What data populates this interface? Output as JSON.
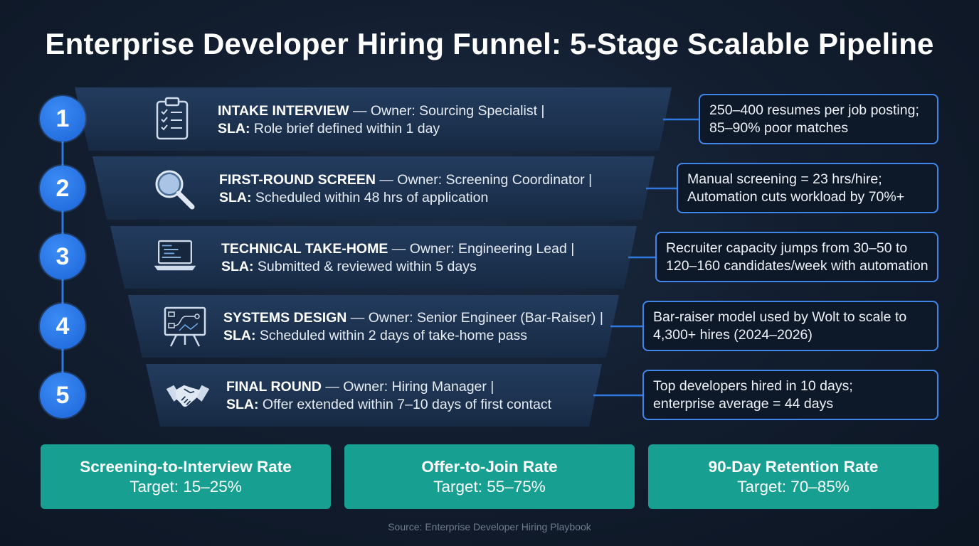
{
  "title": "Enterprise Developer Hiring Funnel: 5-Stage Scalable Pipeline",
  "stages": [
    {
      "number": "1",
      "icon": "clipboard-checklist-icon",
      "name": "INTAKE INTERVIEW",
      "owner_text": " — Owner: Sourcing Specialist |",
      "sla_label": "SLA:",
      "sla_text": " Role brief defined within 1 day",
      "stat_line1": "250–400 resumes per job posting;",
      "stat_line2": "85–90% poor matches"
    },
    {
      "number": "2",
      "icon": "magnifying-glass-icon",
      "name": "FIRST-ROUND SCREEN",
      "owner_text": " — Owner: Screening Coordinator |",
      "sla_label": "SLA:",
      "sla_text": " Scheduled within 48 hrs of application",
      "stat_line1": "Manual screening = 23 hrs/hire;",
      "stat_line2": "Automation cuts workload by 70%+"
    },
    {
      "number": "3",
      "icon": "laptop-code-icon",
      "name": "TECHNICAL TAKE-HOME",
      "owner_text": " — Owner: Engineering Lead |",
      "sla_label": "SLA:",
      "sla_text": " Submitted & reviewed within 5 days",
      "stat_line1": "Recruiter capacity jumps from 30–50 to",
      "stat_line2": "120–160 candidates/week with automation"
    },
    {
      "number": "4",
      "icon": "whiteboard-diagram-icon",
      "name": "SYSTEMS DESIGN",
      "owner_text": " — Owner: Senior Engineer (Bar-Raiser) |",
      "sla_label": "SLA:",
      "sla_text": " Scheduled within 2 days of take-home pass",
      "stat_line1": "Bar-raiser model used by Wolt to scale to",
      "stat_line2": "4,300+ hires (2024–2026)"
    },
    {
      "number": "5",
      "icon": "handshake-icon",
      "name": "FINAL ROUND",
      "owner_text": " — Owner: Hiring Manager |",
      "sla_label": "SLA:",
      "sla_text": " Offer extended within 7–10 days of first contact",
      "stat_line1": "Top developers hired in 10 days;",
      "stat_line2": "enterprise average = 44 days"
    }
  ],
  "kpis": [
    {
      "name": "Screening-to-Interview Rate",
      "target": "Target: 15–25%"
    },
    {
      "name": "Offer-to-Join Rate",
      "target": "Target: 55–75%"
    },
    {
      "name": "90-Day Retention Rate",
      "target": "Target: 70–85%"
    }
  ],
  "source": "Source: Enterprise Developer Hiring Playbook",
  "colors": {
    "background": "#111c2d",
    "accent_blue": "#2b7be8",
    "teal": "#17a092",
    "funnel_band": "#1f3552"
  }
}
